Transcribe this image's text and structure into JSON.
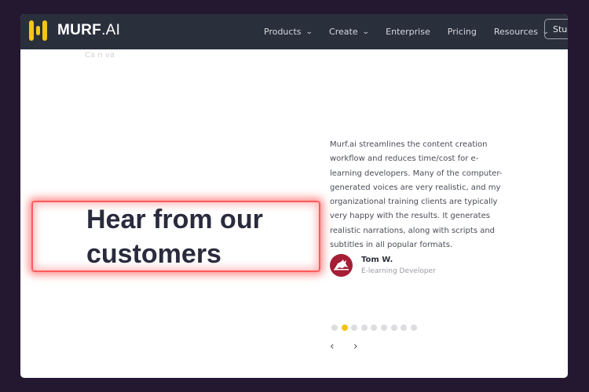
{
  "brand": {
    "name_bold": "MURF",
    "name_thin": ".AI"
  },
  "nav": {
    "items": [
      {
        "label": "Products",
        "has_dropdown": true
      },
      {
        "label": "Create",
        "has_dropdown": true
      },
      {
        "label": "Enterprise",
        "has_dropdown": false
      },
      {
        "label": "Pricing",
        "has_dropdown": false
      },
      {
        "label": "Resources",
        "has_dropdown": true
      }
    ],
    "studio_button": "Studio",
    "chevron": "⌄"
  },
  "overlay_text": "Ca n va",
  "section": {
    "heading": "Hear from our customers",
    "highlight_color": "#ff5b5b"
  },
  "testimonial": {
    "quote": "Murf.ai streamlines the content creation workflow and reduces time/cost for e-learning developers. Many of the computer-generated voices are very realistic, and my organizational training clients are typically very happy with the results. It generates realistic narrations, along with scripts and subtitles in all popular formats.",
    "author_name": "Tom W.",
    "author_role": "E-learning Developer",
    "avatar_color": "#a51e35"
  },
  "carousel": {
    "total_slides": 9,
    "active_index": 1,
    "active_color": "#f4c20d",
    "prev_label": "‹",
    "next_label": "›"
  }
}
